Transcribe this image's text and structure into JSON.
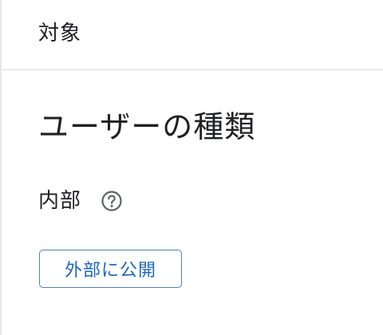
{
  "tab": {
    "title": "対象"
  },
  "section": {
    "title": "ユーザーの種類"
  },
  "user_type": {
    "value": "内部",
    "help_icon": "help-circle-icon"
  },
  "actions": {
    "publish_external_label": "外部に公開"
  },
  "colors": {
    "accent": "#1a66c2",
    "button_border": "#4a7fc1",
    "text": "#202124",
    "divider": "#dadce0"
  }
}
